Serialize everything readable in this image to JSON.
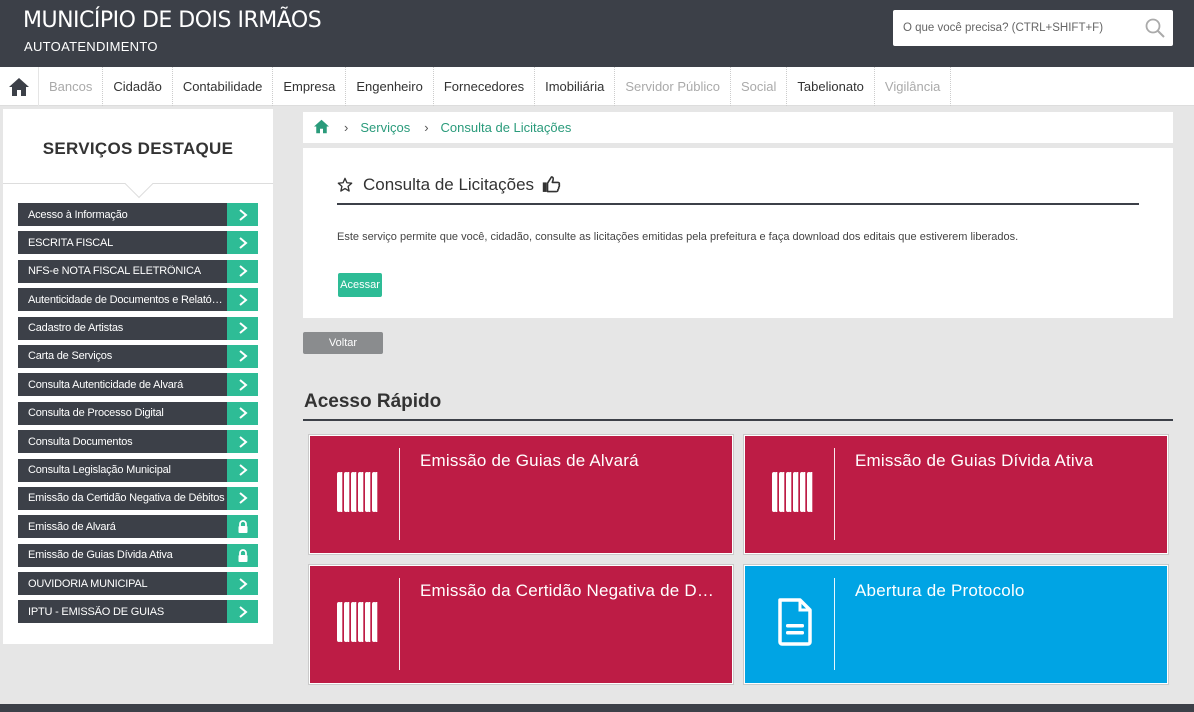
{
  "header": {
    "title": "MUNICÍPIO DE DOIS IRMÃOS",
    "subtitle": "AUTOATENDIMENTO",
    "search_placeholder": "O que você precisa? (CTRL+SHIFT+F)"
  },
  "nav": {
    "items": [
      {
        "label": "Bancos",
        "disabled": true
      },
      {
        "label": "Cidadão",
        "disabled": false
      },
      {
        "label": "Contabilidade",
        "disabled": false
      },
      {
        "label": "Empresa",
        "disabled": false
      },
      {
        "label": "Engenheiro",
        "disabled": false
      },
      {
        "label": "Fornecedores",
        "disabled": false
      },
      {
        "label": "Imobiliária",
        "disabled": false
      },
      {
        "label": "Servidor Público",
        "disabled": true
      },
      {
        "label": "Social",
        "disabled": true
      },
      {
        "label": "Tabelionato",
        "disabled": false
      },
      {
        "label": "Vigilância",
        "disabled": true
      }
    ]
  },
  "sidebar": {
    "title": "SERVIÇOS DESTAQUE",
    "items": [
      {
        "label": "Acesso à Informação",
        "icon": "chevron-right-icon"
      },
      {
        "label": "ESCRITA FISCAL",
        "icon": "chevron-right-icon"
      },
      {
        "label": "NFS-e NOTA FISCAL ELETRÔNICA",
        "icon": "chevron-right-icon"
      },
      {
        "label": "Autenticidade de Documentos e Relatórios",
        "icon": "chevron-right-icon"
      },
      {
        "label": "Cadastro de Artistas",
        "icon": "chevron-right-icon"
      },
      {
        "label": "Carta de Serviços",
        "icon": "chevron-right-icon"
      },
      {
        "label": "Consulta Autenticidade de Alvará",
        "icon": "chevron-right-icon"
      },
      {
        "label": "Consulta de Processo Digital",
        "icon": "chevron-right-icon"
      },
      {
        "label": "Consulta Documentos",
        "icon": "chevron-right-icon"
      },
      {
        "label": "Consulta Legislação Municipal",
        "icon": "chevron-right-icon"
      },
      {
        "label": "Emissão da Certidão Negativa de Débitos",
        "icon": "chevron-right-icon"
      },
      {
        "label": "Emissão de Alvará",
        "icon": "lock-icon"
      },
      {
        "label": "Emissão de Guias Dívida Ativa",
        "icon": "lock-icon"
      },
      {
        "label": "OUVIDORIA MUNICIPAL",
        "icon": "chevron-right-icon"
      },
      {
        "label": "IPTU - EMISSÃO DE GUIAS",
        "icon": "chevron-right-icon"
      }
    ]
  },
  "breadcrumb": {
    "items": [
      "Serviços",
      "Consulta de Licitações"
    ]
  },
  "service": {
    "title": "Consulta de Licitações",
    "description": "Este serviço permite que você, cidadão, consulte as licitações emitidas pela prefeitura e faça download dos editais que estiverem liberados.",
    "access_label": "Acessar",
    "back_label": "Voltar"
  },
  "quick_access": {
    "title": "Acesso Rápido",
    "tiles": [
      {
        "label": "Emissão de Guias de Alvará",
        "icon": "barcode-icon",
        "color": "#bd1c45"
      },
      {
        "label": "Emissão de Guias Dívida Ativa",
        "icon": "barcode-icon",
        "color": "#bd1c45"
      },
      {
        "label": "Emissão da Certidão Negativa de Débitos",
        "icon": "barcode-icon",
        "color": "#bd1c45"
      },
      {
        "label": "Abertura de Protocolo",
        "icon": "document-icon",
        "color": "#00a4e4"
      }
    ]
  },
  "colors": {
    "dark": "#3c4048",
    "accent": "#2ebc96",
    "tile_red": "#bd1c45",
    "tile_blue": "#00a4e4"
  }
}
